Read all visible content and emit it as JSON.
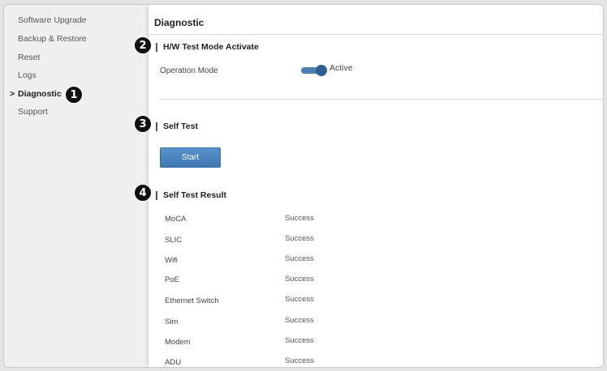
{
  "sidebar": {
    "items": [
      {
        "label": "Software Upgrade"
      },
      {
        "label": "Backup & Restore"
      },
      {
        "label": "Reset"
      },
      {
        "label": "Logs"
      },
      {
        "label": "Diagnostic",
        "active": true
      },
      {
        "label": "Support"
      }
    ],
    "active_chevron": ">"
  },
  "main": {
    "title": "Diagnostic",
    "hw_section": {
      "title": "H/W Test Mode Activate",
      "operation_mode_label": "Operation Mode",
      "toggle_state": "Active",
      "toggle_on": true
    },
    "self_test": {
      "title": "Self Test",
      "start_label": "Start"
    },
    "results": {
      "title": "Self Test Result",
      "rows": [
        {
          "name": "MoCA",
          "status": "Success"
        },
        {
          "name": "SLIC",
          "status": "Success"
        },
        {
          "name": "Wifi",
          "status": "Success"
        },
        {
          "name": "PoE",
          "status": "Success"
        },
        {
          "name": "Ethernet Switch",
          "status": "Success"
        },
        {
          "name": "Sim",
          "status": "Success"
        },
        {
          "name": "Modem",
          "status": "Success"
        },
        {
          "name": "ADU",
          "status": "Success"
        }
      ]
    }
  },
  "callouts": [
    "1",
    "2",
    "3",
    "4"
  ],
  "colors": {
    "accent": "#4d86c0",
    "toggle_knob": "#2f5f93",
    "callout_bg": "#111111"
  }
}
